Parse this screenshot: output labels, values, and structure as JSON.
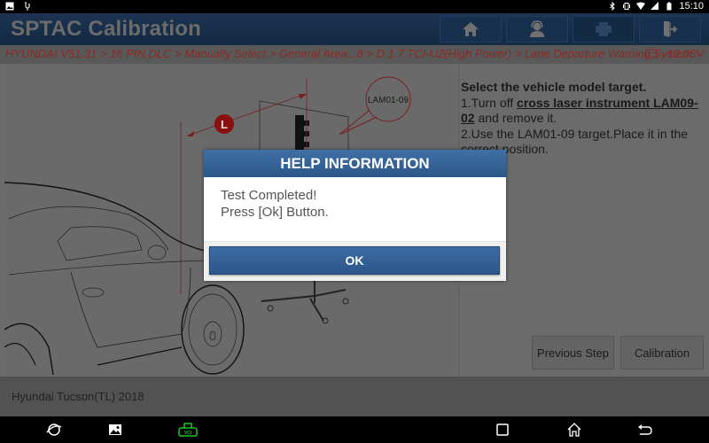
{
  "statusbar": {
    "left_icons": [
      "gallery-notification-icon",
      "usb-icon"
    ],
    "right_icons": [
      "bluetooth-icon",
      "vibrate-icon",
      "wifi-icon",
      "signal-icon",
      "battery-icon"
    ],
    "time": "15:10"
  },
  "header": {
    "title": "SPTAC Calibration",
    "buttons": [
      {
        "name": "home",
        "icon": "home-icon"
      },
      {
        "name": "support",
        "icon": "headset-support-icon"
      },
      {
        "name": "print",
        "icon": "printer-icon"
      },
      {
        "name": "exit",
        "icon": "exit-door-icon"
      }
    ]
  },
  "breadcrumb": {
    "path": "HYUNDAI V51.31 > 16 PIN DLC > Manually Select > General Area...8 > D 1.7 TCI-U2(High Power) > Lane Departure Warning System",
    "battery_icon": "battery-voltage-icon",
    "voltage": "12.08V"
  },
  "illustration": {
    "target_label": "LAM01-09",
    "distance_marker": "L"
  },
  "instructions": {
    "heading": "Select the vehicle model target.",
    "step1_prefix": "1.Turn off ",
    "step1_link": "cross laser instrument LAM09-02",
    "step1_suffix": " and remove it.",
    "step2": "2.Use the LAM01-09 target.Place it in the correct position."
  },
  "actions": {
    "previous_step": "Previous Step",
    "calibration": "Calibration"
  },
  "footer": {
    "vehicle": "Hyundai Tucson(TL) 2018"
  },
  "dialog": {
    "title": "HELP INFORMATION",
    "line1": "Test Completed!",
    "line2": "Press [Ok] Button.",
    "ok_label": "OK"
  },
  "navbar": {
    "icons": [
      "browser-icon",
      "gallery-icon",
      "vci-icon",
      "recent-apps-icon",
      "home-icon",
      "back-icon"
    ],
    "vci_label": "VCI",
    "vci_color": "#1fc11f"
  }
}
